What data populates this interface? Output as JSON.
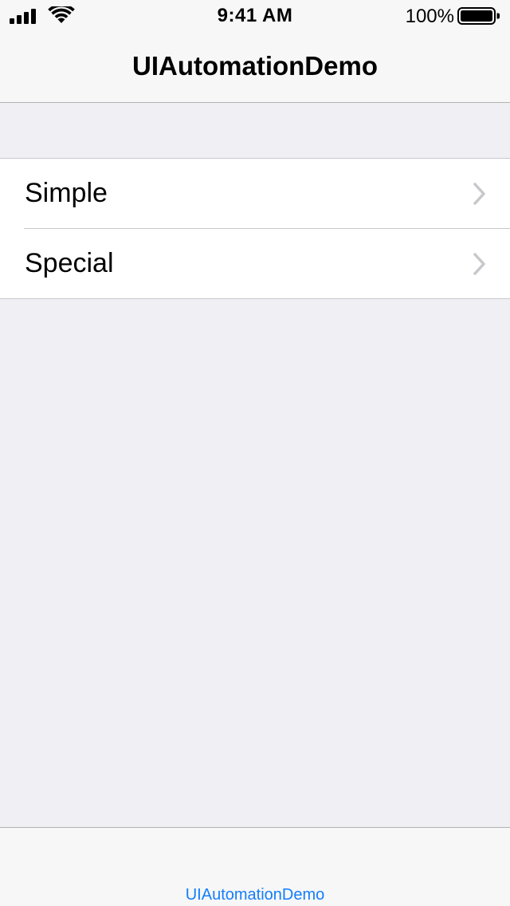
{
  "status_bar": {
    "time": "9:41 AM",
    "battery_percent": "100%",
    "signal_icon": "cellular-signal-icon",
    "wifi_icon": "wifi-icon",
    "battery_icon": "battery-full-icon",
    "battery_level": 1.0
  },
  "nav_bar": {
    "title": "UIAutomationDemo"
  },
  "table": {
    "rows": [
      {
        "label": "Simple",
        "accessory_icon": "chevron-right-icon"
      },
      {
        "label": "Special",
        "accessory_icon": "chevron-right-icon"
      }
    ]
  },
  "toolbar": {
    "link_label": "UIAutomationDemo"
  },
  "colors": {
    "background": "#efeff4",
    "bar_background": "#f7f7f7",
    "tint": "#147efb",
    "separator": "#c8c7cc",
    "chevron": "#c7c7cc"
  }
}
